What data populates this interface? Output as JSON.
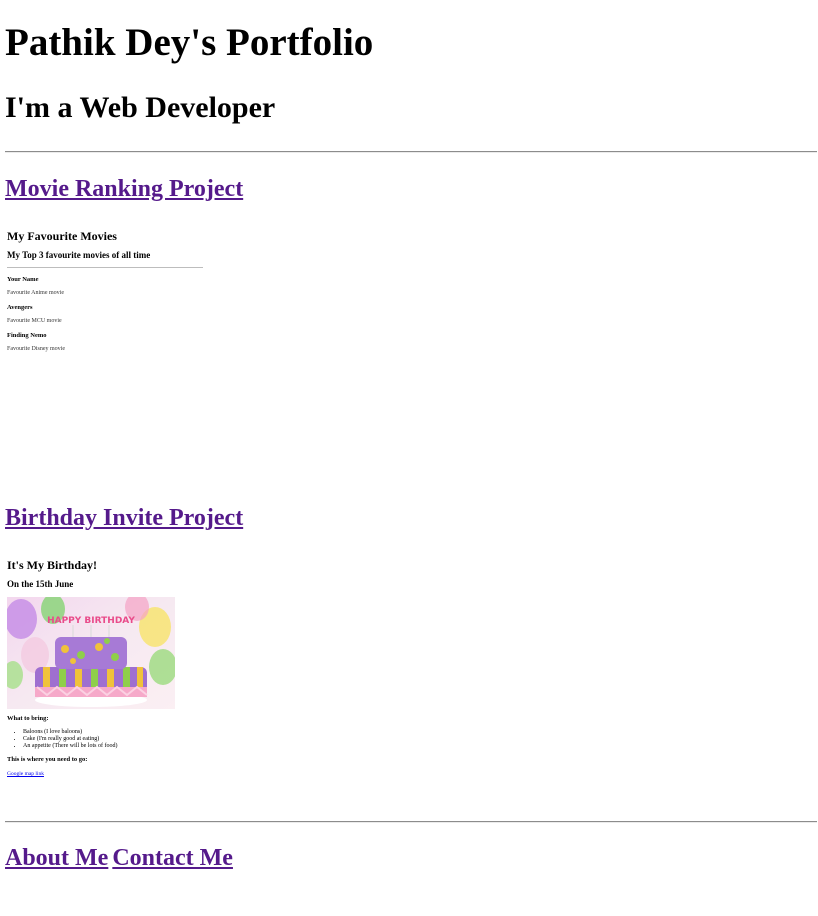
{
  "header": {
    "title": "Pathik Dey's Portfolio",
    "subtitle": "I'm a Web Developer"
  },
  "projects": [
    {
      "link_label": "Movie Ranking Project",
      "embed": {
        "heading": "My Favourite Movies",
        "subheading": "My Top 3 favourite movies of all time",
        "items": [
          {
            "title": "Your Name",
            "description": "Favourite Anime movie"
          },
          {
            "title": "Avengers",
            "description": "Favourite MCU movie"
          },
          {
            "title": "Finding Nemo",
            "description": "Favourite Disney movie"
          }
        ]
      }
    },
    {
      "link_label": "Birthday Invite Project",
      "embed": {
        "heading": "It's My Birthday!",
        "subheading": "On the 15th June",
        "image_text": "HAPPY BIRTHDAY",
        "bring_heading": "What to bring:",
        "bring_items": [
          "Baloons (I love baloons)",
          "Cake (I'm really good at eating)",
          "An appetite (There will be lots of food)"
        ],
        "where_heading": "This is where you need to go:",
        "map_link": "Google map link"
      }
    }
  ],
  "footer": {
    "about_label": "About Me",
    "contact_label": "Contact Me"
  },
  "colors": {
    "visited_link": "#551a8b",
    "link": "#0000ee",
    "rule": "#8c8c8c"
  }
}
